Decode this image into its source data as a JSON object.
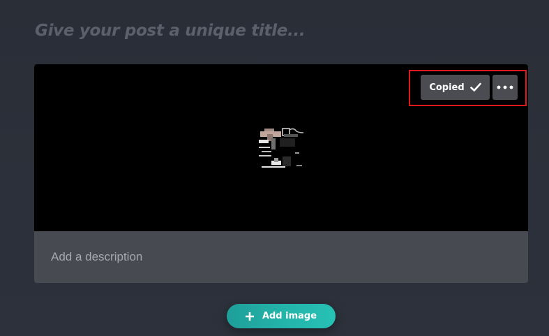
{
  "title": {
    "placeholder": "Give your post a unique title..."
  },
  "card": {
    "copied_label": "Copied",
    "copied_icon": "checkmark-icon",
    "more_icon": "more-options-icon",
    "description_placeholder": "Add a description"
  },
  "add_image": {
    "label": "Add image",
    "icon": "plus-icon"
  },
  "colors": {
    "highlight": "#e0181c",
    "accent": "#23b3a9",
    "background": "#2b303a"
  }
}
